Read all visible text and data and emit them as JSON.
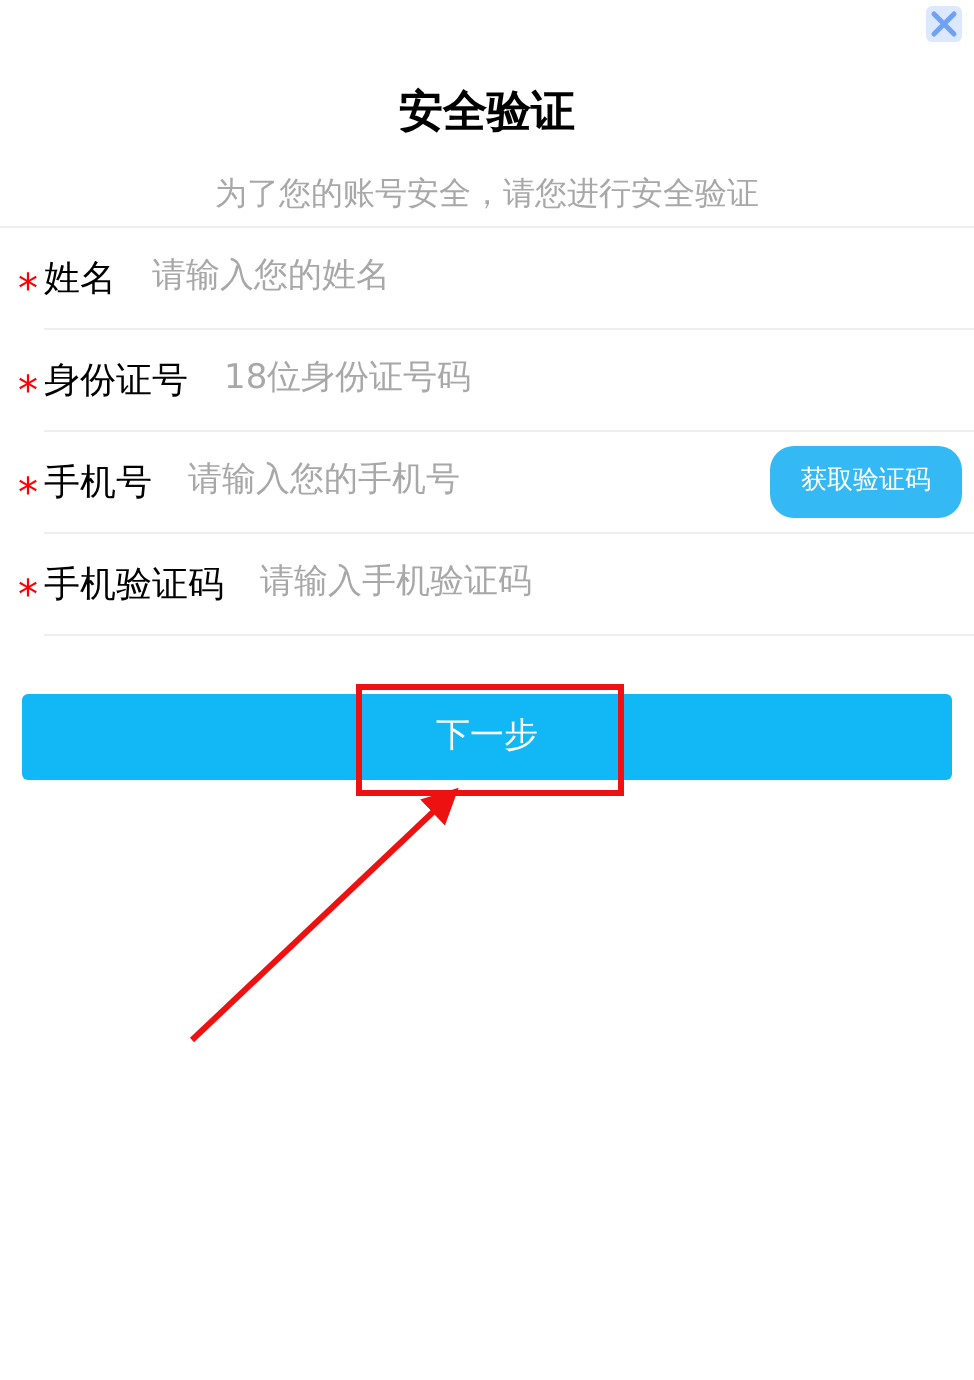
{
  "title": "安全验证",
  "subtitle": "为了您的账号安全，请您进行安全验证",
  "fields": [
    {
      "required_mark": "*",
      "label": "姓名",
      "placeholder": "请输入您的姓名"
    },
    {
      "required_mark": "*",
      "label": "身份证号",
      "placeholder": "18位身份证号码"
    },
    {
      "required_mark": "*",
      "label": "手机号",
      "placeholder": "请输入您的手机号",
      "button": "获取验证码"
    },
    {
      "required_mark": "*",
      "label": "手机验证码",
      "placeholder": "请输入手机验证码"
    }
  ],
  "next_button": "下一步"
}
